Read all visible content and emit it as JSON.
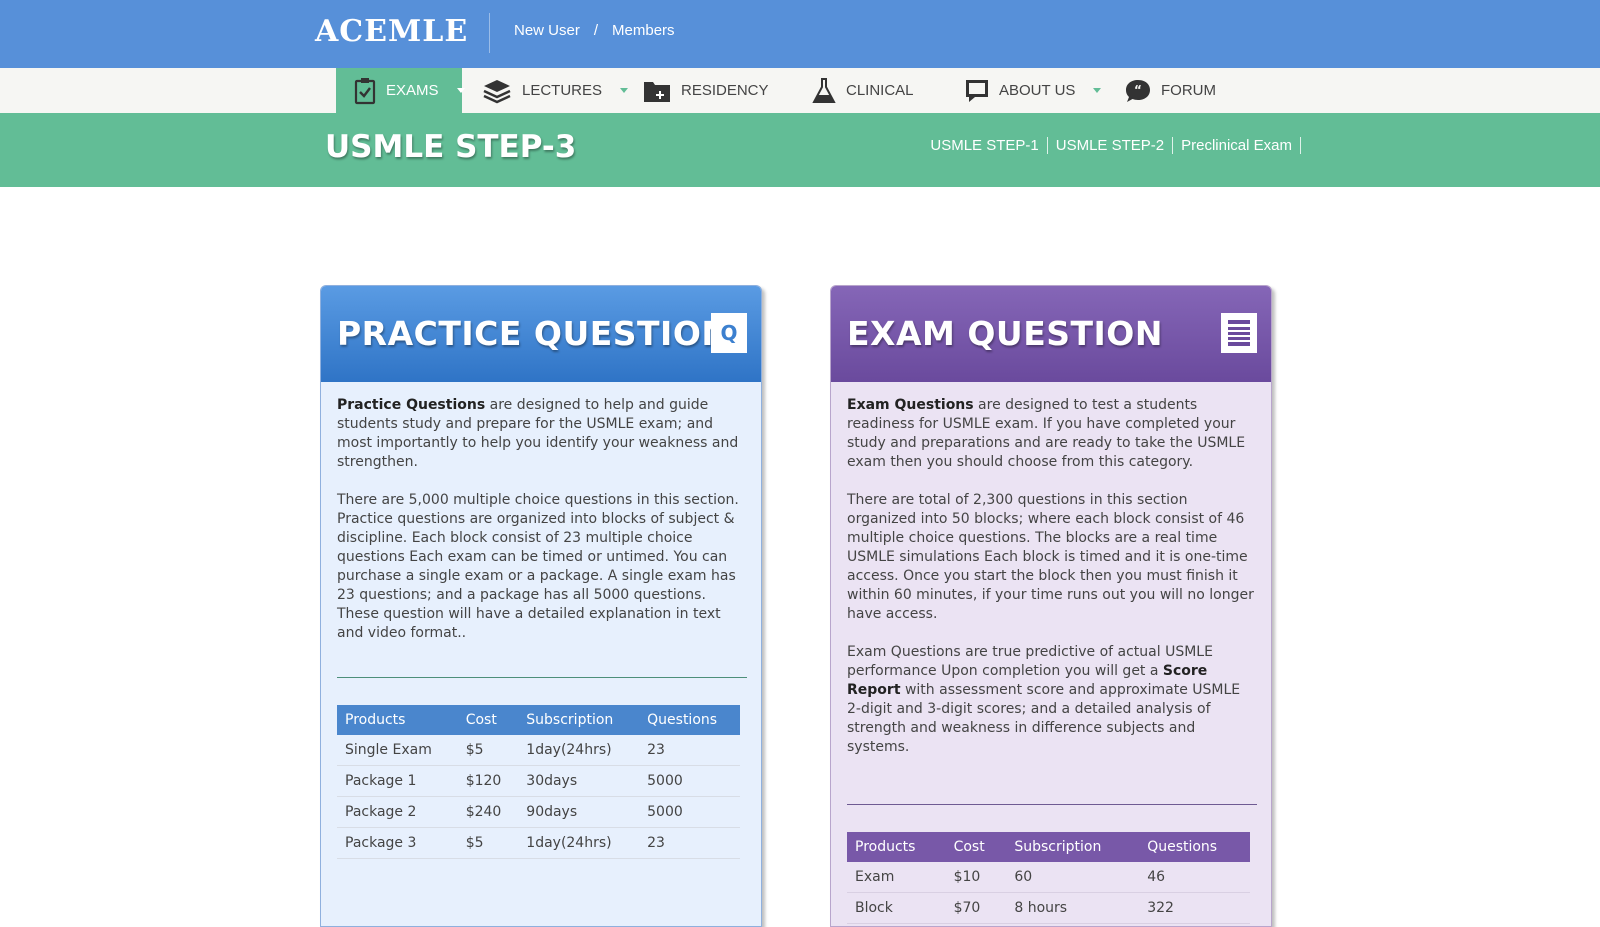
{
  "header": {
    "logo": "ACEMLE",
    "links": [
      "New User",
      "Members"
    ],
    "link_separator": "/"
  },
  "nav": {
    "items": [
      {
        "label": "EXAMS",
        "icon": "clipboard-check-icon",
        "dropdown": true,
        "active": true
      },
      {
        "label": "LECTURES",
        "icon": "layers-icon",
        "dropdown": true
      },
      {
        "label": "RESIDENCY",
        "icon": "folder-add-icon",
        "dropdown": false
      },
      {
        "label": "CLINICAL",
        "icon": "flask-icon",
        "dropdown": false
      },
      {
        "label": "ABOUT US",
        "icon": "chat-bubble-icon",
        "dropdown": true
      },
      {
        "label": "FORUM",
        "icon": "quote-bubble-icon",
        "dropdown": false
      }
    ],
    "active_color": "#62bd96"
  },
  "section": {
    "title": "USMLE STEP-3",
    "links": [
      "USMLE STEP-1",
      "USMLE STEP-2",
      "Preclinical Exam"
    ]
  },
  "practice": {
    "title": "PRACTICE QUESTION",
    "badge": "Q",
    "intro_bold": "Practice Questions",
    "intro_rest": " are designed to help and guide students study and prepare for the USMLE exam; and most importantly to help you identify your weakness and strengthen.",
    "details": "There are 5,000 multiple choice questions in this section. Practice questions are organized into blocks of subject & discipline. Each block consist of 23 multiple choice questions Each exam can be timed or untimed. You can purchase a single exam or a package. A single exam has 23 questions; and a package has all 5000 questions. These question will have a detailed explanation in text and video format..",
    "table": {
      "headers": [
        "Products",
        "Cost",
        "Subscription",
        "Questions"
      ],
      "rows": [
        [
          "Single Exam",
          "$5",
          "1day(24hrs)",
          "23"
        ],
        [
          "Package 1",
          "$120",
          "30days",
          "5000"
        ],
        [
          "Package 2",
          "$240",
          "90days",
          "5000"
        ],
        [
          "Package 3",
          "$5",
          "1day(24hrs)",
          "23"
        ]
      ]
    },
    "color": "#2f74c6"
  },
  "exam": {
    "title": "EXAM QUESTION",
    "badge_icon": "list-icon",
    "intro_bold": "Exam Questions",
    "intro_rest": " are designed to test a students readiness for USMLE exam. If you have completed your study and preparations and are ready to take the USMLE exam then you should choose from this category.",
    "details": "There are total of 2,300 questions in this section organized into 50 blocks; where each block consist of 46 multiple choice questions. The blocks are a real time USMLE simulations Each block is timed and it is one-time access. Once you start the block then you must finish it within 60 minutes, if your time runs out you will no longer have access.",
    "predictive_pre": "Exam Questions are true predictive of actual USMLE performance Upon completion you will get a ",
    "predictive_bold": "Score Report",
    "predictive_post": " with assessment score and approximate USMLE 2-digit and 3-digit scores; and a detailed analysis of strength and weakness in difference subjects and systems.",
    "table": {
      "headers": [
        "Products",
        "Cost",
        "Subscription",
        "Questions"
      ],
      "rows": [
        [
          "Exam",
          "$10",
          "60",
          "46"
        ],
        [
          "Block",
          "$70",
          "8 hours",
          "322"
        ]
      ]
    },
    "color": "#6a4a9d"
  }
}
